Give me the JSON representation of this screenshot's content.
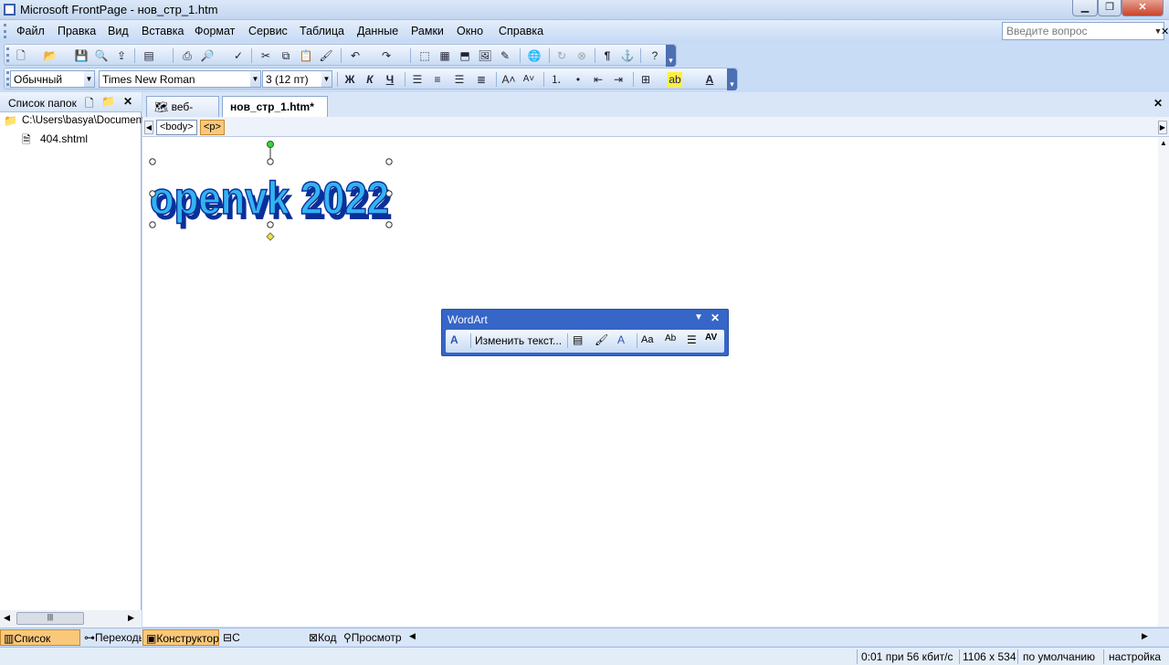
{
  "window": {
    "title": "Microsoft FrontPage - нов_стр_1.htm"
  },
  "menu": {
    "items": [
      "Файл",
      "Правка",
      "Вид",
      "Вставка",
      "Формат",
      "Сервис",
      "Таблица",
      "Данные",
      "Рамки",
      "Окно",
      "Справка"
    ]
  },
  "help": {
    "placeholder": "Введите вопрос"
  },
  "format_toolbar": {
    "style": "Обычный",
    "font": "Times New Roman",
    "size": "3  (12 пт)",
    "bold": "Ж",
    "italic": "К",
    "underline": "Ч"
  },
  "folder_pane": {
    "title": "Список папок",
    "path": "C:\\Users\\basya\\Document",
    "file": "404.shtml"
  },
  "tabs": {
    "site": "веб-узел",
    "doc": "нов_стр_1.htm*"
  },
  "breadcrumb": {
    "body": "<body>",
    "p": "<p>"
  },
  "wordart": {
    "text": "openvk 2022",
    "toolbar_title": "WordArt",
    "edit_label": "Изменить текст..."
  },
  "view_tabs": {
    "folders": "Список папок",
    "nav": "Переходы",
    "design": "Конструктор",
    "split": "С разделением",
    "code": "Код",
    "preview": "Просмотр"
  },
  "status": {
    "speed": "0:01 при 56 кбит/с",
    "size": "1106 x 534",
    "default": "по умолчанию",
    "settings": "настройка"
  },
  "colors": {
    "accent": "#3566c8",
    "wordart_fill": "#33b3f0",
    "wordart_shadow": "#0b2f9a",
    "active_tab": "#f9c87b"
  }
}
